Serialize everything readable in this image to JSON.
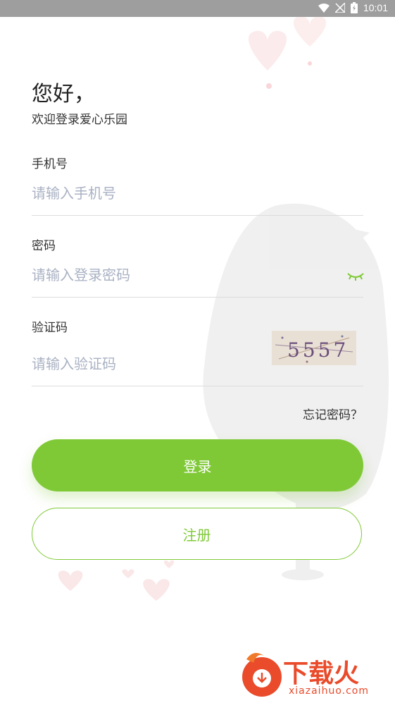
{
  "status": {
    "time": "10:01",
    "wifi_icon": "wifi-icon",
    "signal_icon": "no-signal-icon",
    "battery_icon": "battery-charging-icon"
  },
  "header": {
    "greeting": "您好，",
    "welcome": "欢迎登录爱心乐园"
  },
  "form": {
    "phone": {
      "label": "手机号",
      "placeholder": "请输入手机号",
      "value": ""
    },
    "password": {
      "label": "密码",
      "placeholder": "请输入登录密码",
      "value": "",
      "toggle_icon": "eye-closed-icon"
    },
    "captcha": {
      "label": "验证码",
      "placeholder": "请输入验证码",
      "value": "",
      "image_text": "5557"
    },
    "forgot": "忘记密码？"
  },
  "buttons": {
    "login": "登录",
    "register": "注册"
  },
  "watermark": {
    "title": "下载火",
    "site": "xiazaihuo.com"
  },
  "colors": {
    "accent": "#7fc936",
    "placeholder": "#a9b1c3",
    "statusbar": "#9e9e9e",
    "watermark": "#e94b2b"
  }
}
